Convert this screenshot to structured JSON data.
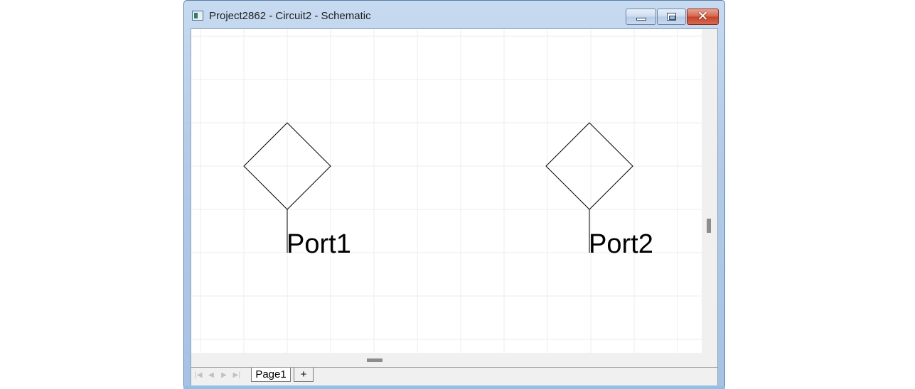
{
  "window": {
    "title": "Project2862 - Circuit2 - Schematic",
    "controls": [
      "minimize",
      "maximize",
      "close"
    ],
    "close_glyph": "✕"
  },
  "canvas": {
    "grid": true,
    "components": [
      {
        "type": "port-symbol",
        "label": "Port1"
      },
      {
        "type": "port-symbol",
        "label": "Port2"
      }
    ]
  },
  "tabs": {
    "nav_buttons": [
      "|◀",
      "◀",
      "▶",
      "▶|"
    ],
    "pages": [
      "Page1"
    ],
    "add_label": "+"
  },
  "colors": {
    "titlebar": "#b3cbe8",
    "close_button": "#c2432b",
    "grid_line": "#ececec",
    "scrollbar_thumb": "#8c8c8c"
  }
}
